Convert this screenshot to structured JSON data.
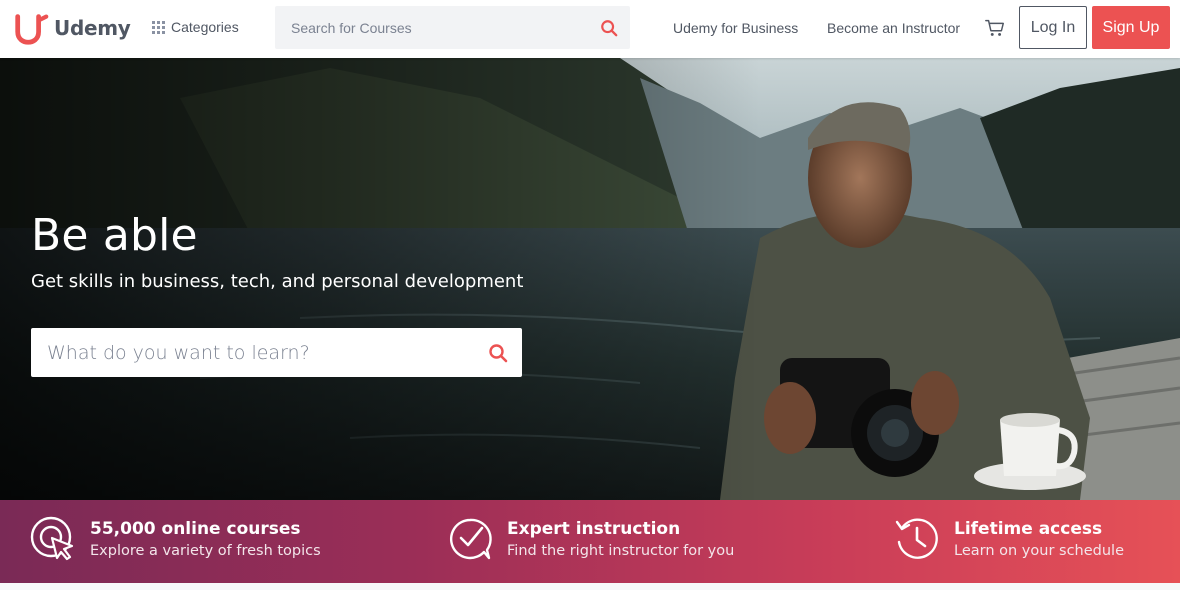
{
  "brand": {
    "name": "Udemy",
    "color": "#ec5252"
  },
  "header": {
    "categories_label": "Categories",
    "search_placeholder": "Search for Courses",
    "business_link": "Udemy for Business",
    "instructor_link": "Become an Instructor",
    "cart_icon": "shopping-cart-icon",
    "login_label": "Log In",
    "signup_label": "Sign Up"
  },
  "hero": {
    "title": "Be able",
    "subtitle": "Get skills in business, tech, and personal development",
    "search_placeholder": "What do you want to learn?"
  },
  "value_props": [
    {
      "icon": "cursor-target-icon",
      "title": "55,000 online courses",
      "desc": "Explore a variety of fresh topics"
    },
    {
      "icon": "checkmark-bubble-icon",
      "title": "Expert instruction",
      "desc": "Find the right instructor for you"
    },
    {
      "icon": "clock-history-icon",
      "title": "Lifetime access",
      "desc": "Learn on your schedule"
    }
  ]
}
